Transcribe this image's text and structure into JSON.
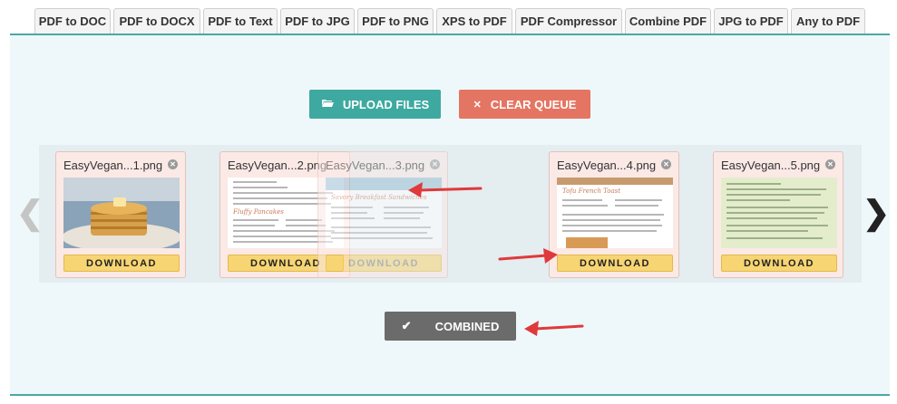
{
  "tabs": [
    {
      "label": "PDF to DOC"
    },
    {
      "label": "PDF to DOCX"
    },
    {
      "label": "PDF to Text"
    },
    {
      "label": "PDF to JPG"
    },
    {
      "label": "PDF to PNG"
    },
    {
      "label": "XPS to PDF"
    },
    {
      "label": "PDF Compressor"
    },
    {
      "label": "Combine PDF"
    },
    {
      "label": "JPG to PDF"
    },
    {
      "label": "Any to PDF"
    }
  ],
  "toolbar": {
    "upload_label": "UPLOAD FILES",
    "clear_label": "CLEAR QUEUE",
    "upload_icon": "folder-open-icon",
    "clear_icon": "close-icon"
  },
  "files": [
    {
      "name": "EasyVegan...1.png",
      "download_label": "DOWNLOAD"
    },
    {
      "name": "EasyVegan...2.png",
      "download_label": "DOWNLOAD"
    },
    {
      "name": "EasyVegan...3.png",
      "download_label": "DOWNLOAD"
    },
    {
      "name": "EasyVegan...4.png",
      "download_label": "DOWNLOAD"
    },
    {
      "name": "EasyVegan...5.png",
      "download_label": "DOWNLOAD"
    }
  ],
  "thumb_titles": {
    "file2": "Fluffy Pancakes",
    "file3": "Savory Breakfast Sandwiches",
    "file4": "Tofu French Toast"
  },
  "nav": {
    "prev": "❮",
    "next": "❯"
  },
  "combined_label": "COMBINED",
  "colors": {
    "accent": "#3ea9a0",
    "clear": "#e47563",
    "download": "#f7d573",
    "combined": "#6b6b6b",
    "annotation_arrow": "#e0393b"
  }
}
